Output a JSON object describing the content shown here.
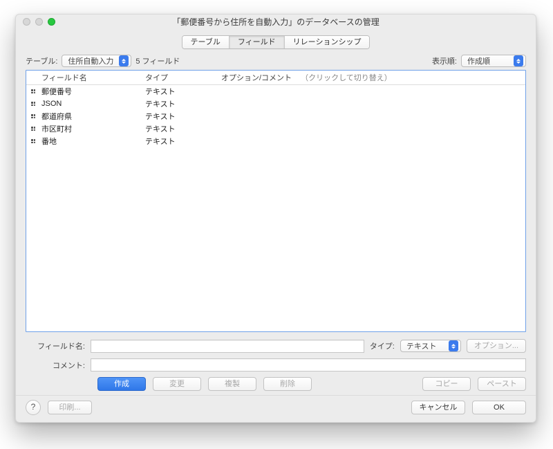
{
  "window": {
    "title": "「郵便番号から住所を自動入力」のデータベースの管理"
  },
  "tabs": [
    "テーブル",
    "フィールド",
    "リレーションシップ"
  ],
  "selectors": {
    "table_label": "テーブル:",
    "table_value": "住所自動入力",
    "field_count": "5 フィールド",
    "view_label": "表示順:",
    "view_value": "作成順"
  },
  "columns": {
    "name": "フィールド名",
    "type": "タイプ",
    "options": "オプション/コメント",
    "options_hint": "（クリックして切り替え）"
  },
  "fields": [
    {
      "name": "郵便番号",
      "type": "テキスト"
    },
    {
      "name": "JSON",
      "type": "テキスト"
    },
    {
      "name": "都道府県",
      "type": "テキスト"
    },
    {
      "name": "市区町村",
      "type": "テキスト"
    },
    {
      "name": "番地",
      "type": "テキスト"
    }
  ],
  "form": {
    "field_name_label": "フィールド名:",
    "field_name_value": "",
    "type_label": "タイプ:",
    "type_value": "テキスト",
    "options_button": "オプション...",
    "comment_label": "コメント:",
    "comment_value": ""
  },
  "buttons": {
    "create": "作成",
    "change": "変更",
    "duplicate": "複製",
    "delete": "削除",
    "copy": "コピー",
    "paste": "ペースト",
    "print": "印刷...",
    "cancel": "キャンセル",
    "ok": "OK"
  }
}
